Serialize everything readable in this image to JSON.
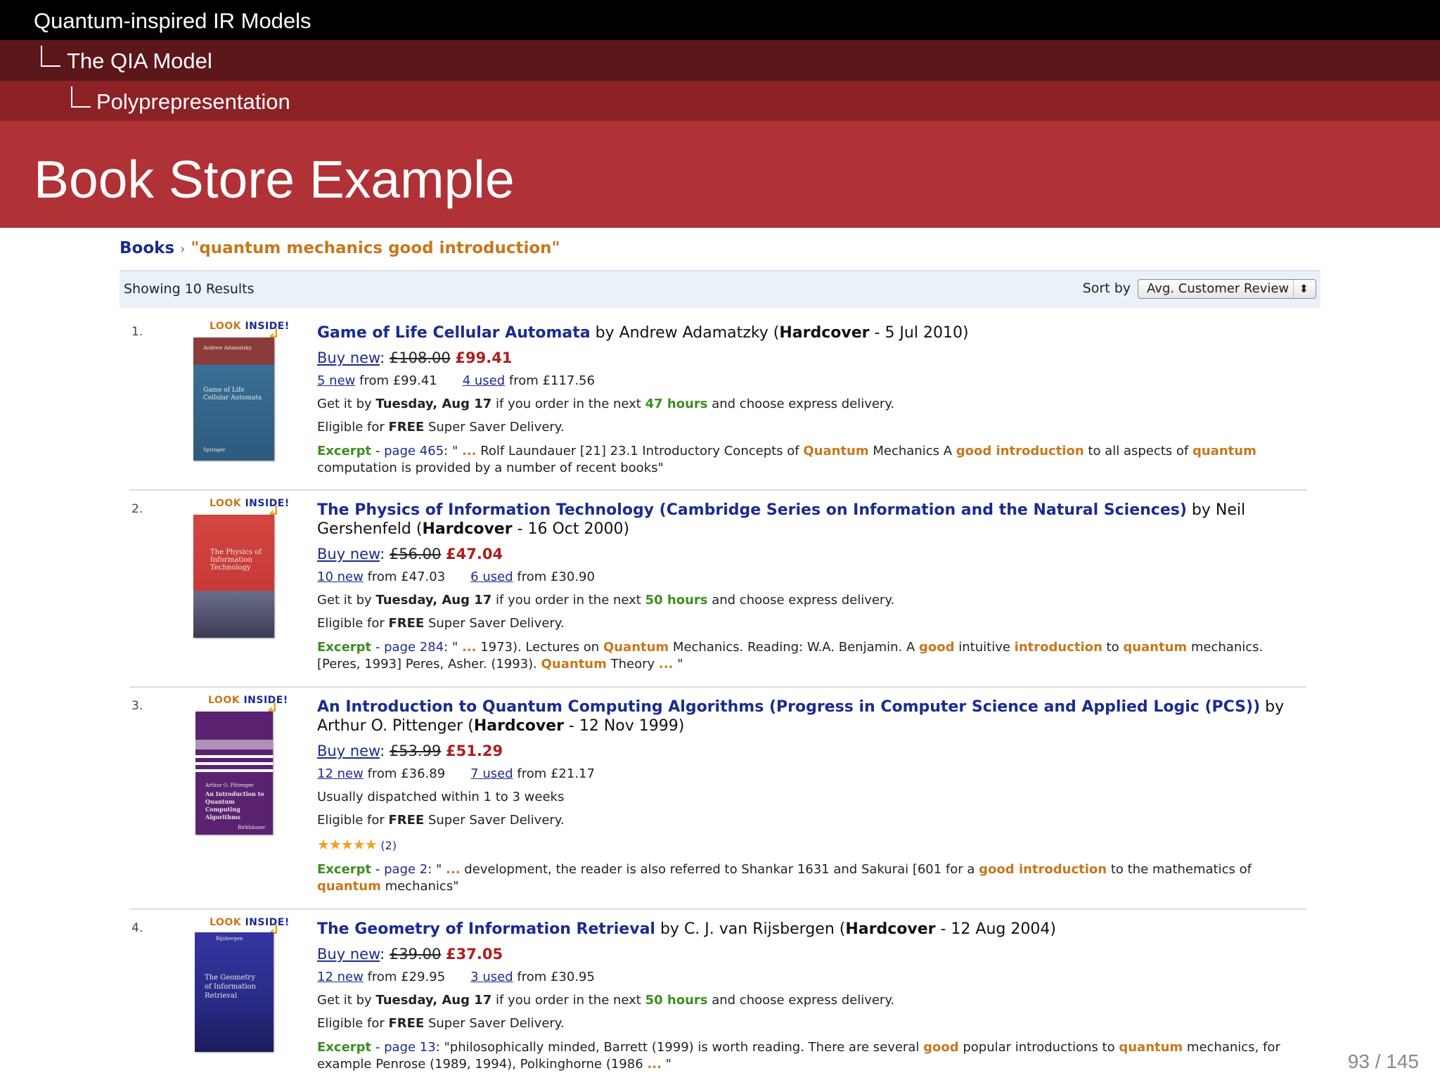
{
  "header": {
    "section": "Quantum-inspired IR Models",
    "subsection": "The QIA Model",
    "subsubsection": "Polyprepresentation",
    "frame_title": "Book Store Example"
  },
  "store": {
    "breadcrumb_category": "Books",
    "breadcrumb_separator": "›",
    "breadcrumb_query": "\"quantum mechanics good introduction\"",
    "result_count": "Showing 10 Results",
    "sort_label": "Sort by",
    "sort_value": "Avg. Customer Review",
    "sort_arrow": "⬍",
    "look_inside_a": "LOOK",
    "look_inside_b": "INSIDE!",
    "look_arrow": "↲"
  },
  "results": [
    {
      "number": "1.",
      "title": "Game of Life Cellular Automata",
      "by": " by Andrew Adamatzky (",
      "format": "Hardcover",
      "date": " - 5 Jul 2010)",
      "buy_new": "Buy new",
      "old_price": "£108.00",
      "price": "£99.41",
      "new_link": "5 new",
      "new_from": " from £99.41",
      "used_link": "4 used",
      "used_from": " from £117.56",
      "delivery_a": "Get it by ",
      "delivery_day": "Tuesday, Aug 17",
      "delivery_b": " if you order in the next ",
      "delivery_hours": "47 hours",
      "delivery_c": " and choose express delivery.",
      "eligible_a": "Eligible for ",
      "eligible_free": "FREE",
      "eligible_b": " Super Saver Delivery.",
      "excerpt_label": "Excerpt",
      "excerpt_page": "page 465",
      "excerpt_text": [
        {
          "t": ": \" ",
          "c": ""
        },
        {
          "t": "...",
          "c": "orange"
        },
        {
          "t": " Rolf Laundauer [21] 23.1 Introductory Concepts of ",
          "c": ""
        },
        {
          "t": "Quantum",
          "c": "orange"
        },
        {
          "t": " Mechanics A ",
          "c": ""
        },
        {
          "t": "good introduction",
          "c": "orange"
        },
        {
          "t": " to all aspects of ",
          "c": ""
        },
        {
          "t": "quantum",
          "c": "orange"
        },
        {
          "t": " computation is provided by a number of recent books\"",
          "c": ""
        }
      ],
      "cover_title": "Game of Life Cellular Automata",
      "cover_author": "Andrew Adamatzky",
      "cover_publisher": "Springer",
      "cover_color": "#3a6f97"
    },
    {
      "number": "2.",
      "title": "The Physics of Information Technology (Cambridge Series on Information and the Natural Sciences)",
      "by": " by Neil Gershenfeld (",
      "format": "Hardcover",
      "date": " - 16 Oct 2000)",
      "buy_new": "Buy new",
      "old_price": "£56.00",
      "price": "£47.04",
      "new_link": "10 new",
      "new_from": " from £47.03",
      "used_link": "6 used",
      "used_from": " from £30.90",
      "delivery_a": "Get it by ",
      "delivery_day": "Tuesday, Aug 17",
      "delivery_b": " if you order in the next ",
      "delivery_hours": "50 hours",
      "delivery_c": " and choose express delivery.",
      "eligible_a": "Eligible for ",
      "eligible_free": "FREE",
      "eligible_b": " Super Saver Delivery.",
      "excerpt_label": "Excerpt",
      "excerpt_page": "page 284",
      "excerpt_text": [
        {
          "t": ": \" ",
          "c": ""
        },
        {
          "t": "...",
          "c": "orange"
        },
        {
          "t": " 1973). Lectures on ",
          "c": ""
        },
        {
          "t": "Quantum",
          "c": "orange"
        },
        {
          "t": " Mechanics. Reading: W.A. Benjamin. A ",
          "c": ""
        },
        {
          "t": "good",
          "c": "orange"
        },
        {
          "t": " intuitive ",
          "c": ""
        },
        {
          "t": "introduction",
          "c": "orange"
        },
        {
          "t": " to ",
          "c": ""
        },
        {
          "t": "quantum",
          "c": "orange"
        },
        {
          "t": " mechanics. [Peres, 1993] Peres, Asher. (1993). ",
          "c": ""
        },
        {
          "t": "Quantum",
          "c": "orange"
        },
        {
          "t": " Theory ",
          "c": ""
        },
        {
          "t": "...",
          "c": "orange"
        },
        {
          "t": " \"",
          "c": ""
        }
      ],
      "cover_title": "The Physics of Information Technology",
      "cover_author": "",
      "cover_publisher": "",
      "cover_color": "#c73a37"
    },
    {
      "number": "3.",
      "title": "An Introduction to Quantum Computing Algorithms (Progress in Computer Science and Applied Logic (PCS))",
      "by": " by Arthur O. Pittenger (",
      "format": "Hardcover",
      "date": " - 12 Nov 1999)",
      "buy_new": "Buy new",
      "old_price": "£53.99",
      "price": "£51.29",
      "new_link": "12 new",
      "new_from": " from £36.89",
      "used_link": "7 used",
      "used_from": " from £21.17",
      "delivery_plain": "Usually dispatched within 1 to 3 weeks",
      "eligible_a": "Eligible for ",
      "eligible_free": "FREE",
      "eligible_b": " Super Saver Delivery.",
      "stars": "★★★★★",
      "rating": 5,
      "review_count": "(2)",
      "excerpt_label": "Excerpt",
      "excerpt_page": "page 2",
      "excerpt_text": [
        {
          "t": ": \" ",
          "c": ""
        },
        {
          "t": "...",
          "c": "orange"
        },
        {
          "t": " development, the reader is also referred to Shankar 1631 and Sakurai [601 for a ",
          "c": ""
        },
        {
          "t": "good introduction",
          "c": "orange"
        },
        {
          "t": " to the mathematics of ",
          "c": ""
        },
        {
          "t": "quantum",
          "c": "orange"
        },
        {
          "t": " mechanics\"",
          "c": ""
        }
      ],
      "cover_title": "An Introduction to Quantum Computing Algorithms",
      "cover_author": "Arthur O. Pittenger",
      "cover_publisher": "Birkhäuser",
      "cover_color": "#5a2270"
    },
    {
      "number": "4.",
      "title": "The Geometry of Information Retrieval",
      "by": " by C. J. van Rijsbergen (",
      "format": "Hardcover",
      "date": " - 12 Aug 2004)",
      "buy_new": "Buy new",
      "old_price": "£39.00",
      "price": "£37.05",
      "new_link": "12 new",
      "new_from": " from £29.95",
      "used_link": "3 used",
      "used_from": " from £30.95",
      "delivery_a": "Get it by ",
      "delivery_day": "Tuesday, Aug 17",
      "delivery_b": " if you order in the next ",
      "delivery_hours": "50 hours",
      "delivery_c": " and choose express delivery.",
      "eligible_a": "Eligible for ",
      "eligible_free": "FREE",
      "eligible_b": " Super Saver Delivery.",
      "excerpt_label": "Excerpt",
      "excerpt_page": "page 13",
      "excerpt_text": [
        {
          "t": ": \"philosophically minded, Barrett (1999) is worth reading. There are several ",
          "c": ""
        },
        {
          "t": "good",
          "c": "orange"
        },
        {
          "t": " popular introductions to ",
          "c": ""
        },
        {
          "t": "quantum",
          "c": "orange"
        },
        {
          "t": " mechanics, for example Penrose (1989, 1994), Polkinghorne (1986 ",
          "c": ""
        },
        {
          "t": "...",
          "c": "orange"
        },
        {
          "t": " \"",
          "c": ""
        }
      ],
      "cover_title": "The Geometry of Information Retrieval",
      "cover_author": "Rijsbergen",
      "cover_publisher": "",
      "cover_color": "#2a2a86"
    }
  ],
  "footer": {
    "page_number": "93 / 145"
  },
  "colors": {
    "header_black": "#000000",
    "header_dark": "#5c171a",
    "header_mid": "#8c2226",
    "title_red": "#b03236",
    "link_blue": "#1b2c8f",
    "price_red": "#b01c1c",
    "highlight_orange": "#c7771b",
    "hours_green": "#3d8f1f"
  }
}
